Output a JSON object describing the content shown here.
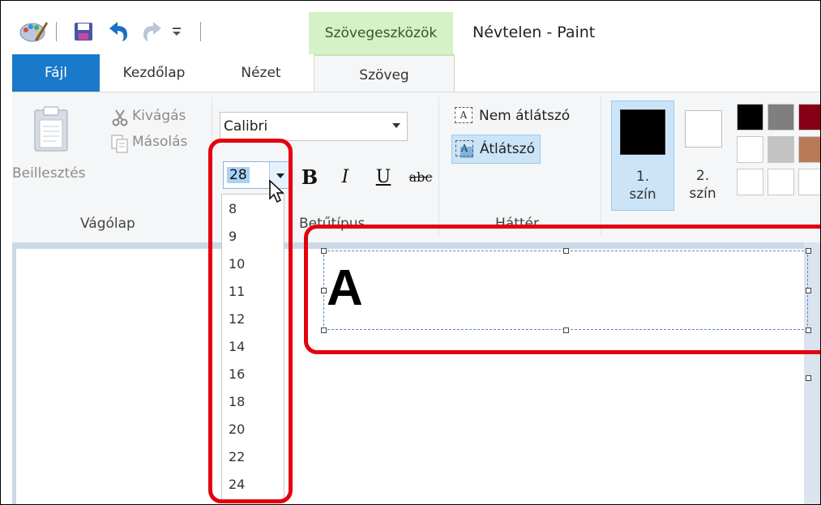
{
  "window": {
    "title": "Névtelen - Paint",
    "context_tab_group": "Szövegeszközök"
  },
  "tabs": [
    {
      "label": "Fájl",
      "state": "file"
    },
    {
      "label": "Kezdőlap"
    },
    {
      "label": "Nézet"
    },
    {
      "label": "Szöveg",
      "state": "active"
    }
  ],
  "clipboard": {
    "paste_label": "Beillesztés",
    "cut_label": "Kivágás",
    "copy_label": "Másolás",
    "group_label": "Vágólap"
  },
  "font": {
    "family_value": "Calibri",
    "size_value": "28",
    "bold_label": "B",
    "italic_label": "I",
    "underline_label": "U",
    "strike_label": "abc",
    "group_label": "Betűtípus",
    "size_options": [
      "8",
      "9",
      "10",
      "11",
      "12",
      "14",
      "16",
      "18",
      "20",
      "22",
      "24"
    ]
  },
  "background": {
    "opaque_label": "Nem átlátszó",
    "transparent_label": "Átlátszó",
    "selected": "transparent",
    "group_label": "Háttér",
    "icon_glyph": "A"
  },
  "colors": {
    "color1_label_line1": "1.",
    "color1_label_line2": "szín",
    "color2_label_line1": "2.",
    "color2_label_line2": "szín",
    "color1": "#000000",
    "color2": "#ffffff",
    "palette": [
      "#000000",
      "#7f7f7f",
      "#880015",
      "#ffffff",
      "#c3c3c3",
      "#b97a57",
      "#ffffff",
      "#ffffff",
      "#ffffff"
    ]
  },
  "canvas": {
    "text": "A"
  },
  "theme": {
    "file_tab": "#1979ca",
    "context_tab": "#d5f1c6",
    "selection": "#cce4f7",
    "highlight": "#e3000f"
  }
}
